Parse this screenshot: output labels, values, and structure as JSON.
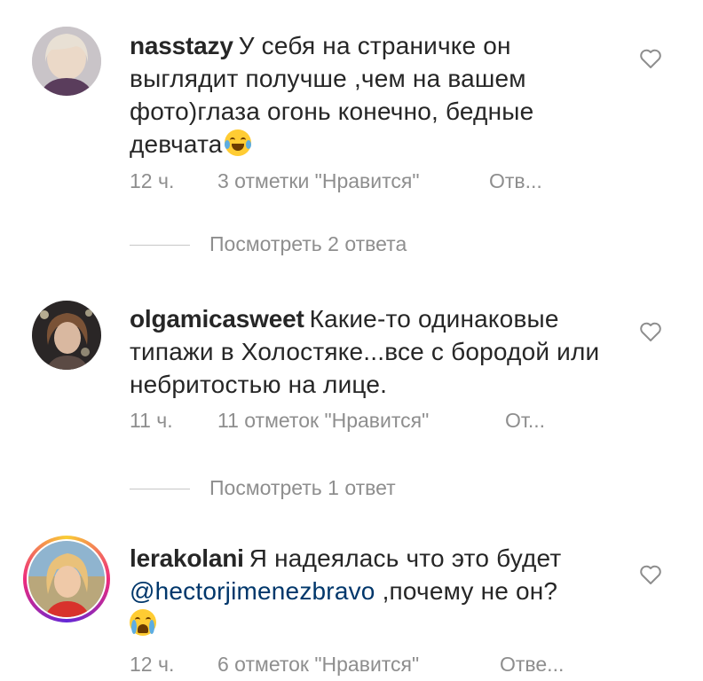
{
  "comments": [
    {
      "username": "nasstazy",
      "text": "У себя на страничке он выглядит получше ,чем на вашем фото)глаза огонь конечно, бедные девчата",
      "emoji": "face-with-tears-of-joy",
      "time": "12 ч.",
      "likes": "3 отметки \"Нравится\"",
      "reply": "Отв..."
    },
    {
      "username": "olgamicasweet",
      "text": "Какие-то одинаковые типажи в Холостяке...все с бородой или небритостью на лице.",
      "time": "11 ч.",
      "likes": "11 отметок \"Нравится\"",
      "reply": "От..."
    },
    {
      "username": "lerakolani",
      "text_before": "Я надеялась что это будет",
      "mention": "@hectorjimenezbravo",
      "text_after": ",почему не он?",
      "emoji": "loudly-crying-face",
      "time": "12 ч.",
      "likes": "6 отметок \"Нравится\"",
      "reply": "Отве..."
    }
  ],
  "view_replies": [
    "Посмотреть 2 ответа",
    "Посмотреть 1 ответ"
  ],
  "icons": {
    "like": "heart-outline-icon"
  },
  "colors": {
    "text": "#262626",
    "secondary": "#8e8e8e",
    "mention": "#00376b"
  }
}
